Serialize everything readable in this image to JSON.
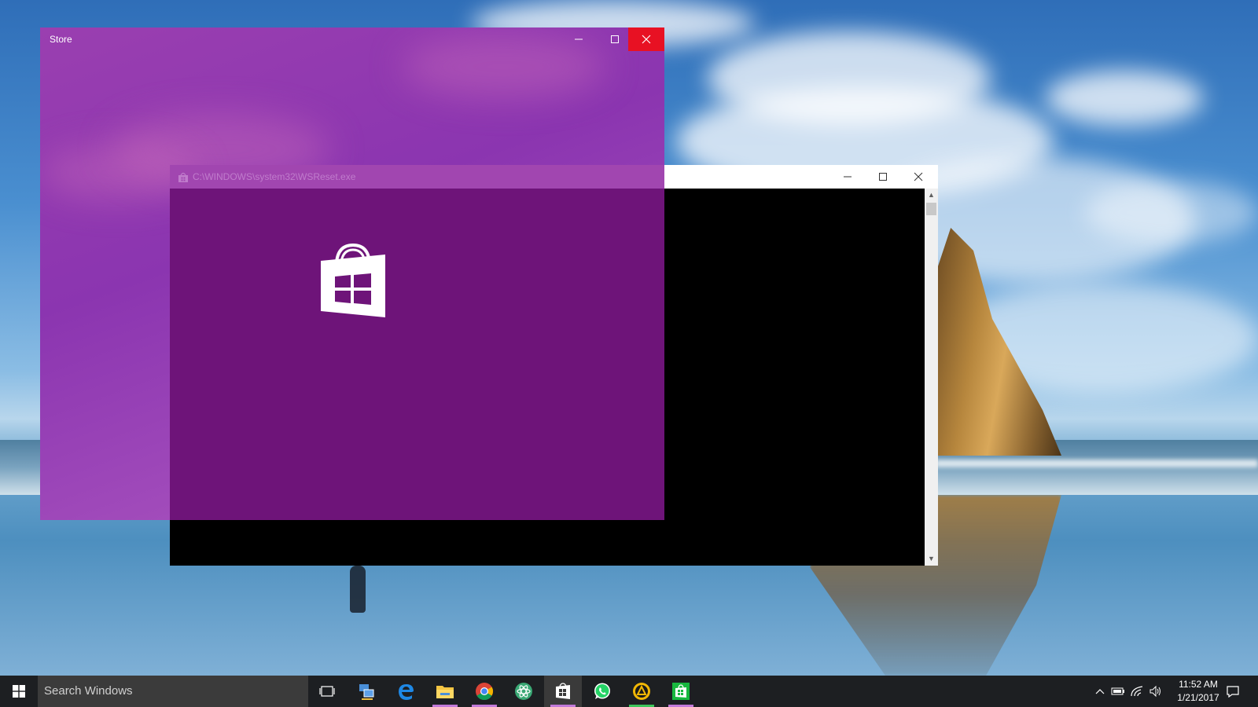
{
  "windows": {
    "store": {
      "title": "Store",
      "minimize_icon": "minimize-icon",
      "maximize_icon": "maximize-icon",
      "close_icon": "close-icon",
      "close_color": "#e81123"
    },
    "console": {
      "title": "C:\\WINDOWS\\system32\\WSReset.exe",
      "minimize_icon": "minimize-icon",
      "maximize_icon": "maximize-icon",
      "close_icon": "close-icon"
    },
    "splash": {
      "logo": "store-bag-icon",
      "background_color": "#6e1479"
    }
  },
  "taskbar": {
    "search_placeholder": "Search Windows",
    "apps": [
      {
        "name": "task-view-icon"
      },
      {
        "name": "network-tool-icon"
      },
      {
        "name": "edge-icon"
      },
      {
        "name": "file-explorer-icon"
      },
      {
        "name": "chrome-icon"
      },
      {
        "name": "atom-app-icon"
      },
      {
        "name": "store-icon",
        "active": true
      },
      {
        "name": "whatsapp-icon"
      },
      {
        "name": "ccleaner-icon"
      },
      {
        "name": "store-green-icon"
      }
    ],
    "tray": {
      "chevron_icon": "show-hidden-icons-icon",
      "power_icon": "battery-icon",
      "network_icon": "wifi-icon",
      "volume_icon": "volume-icon"
    },
    "clock": {
      "time": "11:52 AM",
      "date": "1/21/2017"
    },
    "action_center_icon": "notifications-icon"
  }
}
